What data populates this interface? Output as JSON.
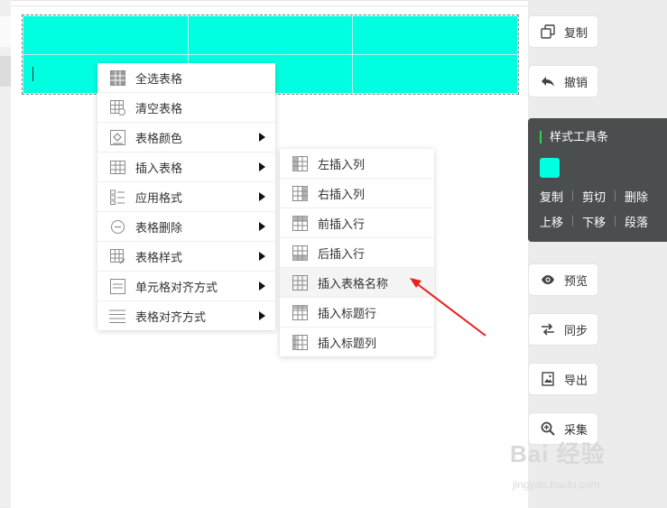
{
  "context_menu": {
    "items": [
      {
        "label": "全选表格",
        "icon": "table-select-all-icon",
        "has_submenu": false
      },
      {
        "label": "清空表格",
        "icon": "table-clear-icon",
        "has_submenu": false
      },
      {
        "label": "表格颜色",
        "icon": "paint-bucket-icon",
        "has_submenu": true
      },
      {
        "label": "插入表格",
        "icon": "table-insert-icon",
        "has_submenu": true
      },
      {
        "label": "应用格式",
        "icon": "apply-format-icon",
        "has_submenu": true
      },
      {
        "label": "表格删除",
        "icon": "minus-circle-icon",
        "has_submenu": true
      },
      {
        "label": "表格样式",
        "icon": "table-style-icon",
        "has_submenu": true
      },
      {
        "label": "单元格对齐方式",
        "icon": "cell-align-icon",
        "has_submenu": true
      },
      {
        "label": "表格对齐方式",
        "icon": "table-align-icon",
        "has_submenu": true
      }
    ]
  },
  "insert_submenu": {
    "items": [
      {
        "label": "左插入列",
        "icon": "insert-col-left-icon"
      },
      {
        "label": "右插入列",
        "icon": "insert-col-right-icon"
      },
      {
        "label": "前插入行",
        "icon": "insert-row-before-icon"
      },
      {
        "label": "后插入行",
        "icon": "insert-row-after-icon"
      },
      {
        "label": "插入表格名称",
        "icon": "insert-table-name-icon",
        "highlighted": true
      },
      {
        "label": "插入标题行",
        "icon": "insert-header-row-icon"
      },
      {
        "label": "插入标题列",
        "icon": "insert-header-col-icon"
      }
    ]
  },
  "right_toolbar": {
    "copy": "复制",
    "undo": "撤销",
    "preview": "预览",
    "sync": "同步",
    "export": "导出",
    "collect": "采集"
  },
  "style_toolbar": {
    "title": "样式工具条",
    "swatch_color": "#00ffe1",
    "row1": [
      "复制",
      "剪切",
      "删除"
    ],
    "row2": [
      "上移",
      "下移",
      "段落"
    ]
  },
  "table": {
    "fill_color": "#00ffe1",
    "rows": 2,
    "cols": 3
  },
  "watermark": {
    "brand": "Bai 经验",
    "url": "jingyan.baidu.com"
  },
  "colors": {
    "accent": "#00ffe1",
    "stylebar_bg": "#4a4e4e",
    "arrow": "#e8211f"
  }
}
